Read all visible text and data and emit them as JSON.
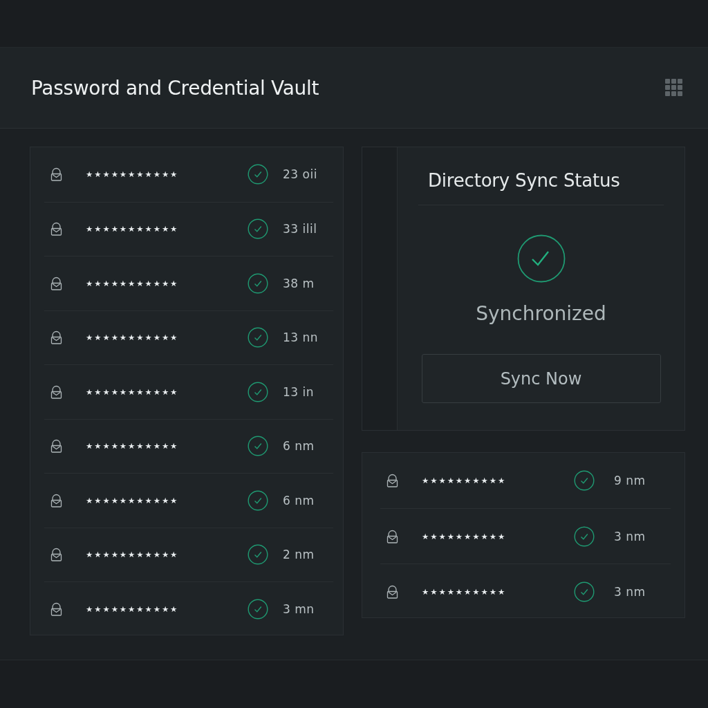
{
  "header": {
    "title": "Password and Credential Vault"
  },
  "credentials": [
    {
      "secret": "★★★★★★★★★★★",
      "time": "23 oii"
    },
    {
      "secret": "★★★★★★★★★★★",
      "time": "33 ilil"
    },
    {
      "secret": "★★★★★★★★★★★",
      "time": "38 m"
    },
    {
      "secret": "★★★★★★★★★★★",
      "time": "13 nn"
    },
    {
      "secret": "★★★★★★★★★★★",
      "time": "13 in"
    },
    {
      "secret": "★★★★★★★★★★★",
      "time": "6 nm"
    },
    {
      "secret": "★★★★★★★★★★★",
      "time": "6 nm"
    },
    {
      "secret": "★★★★★★★★★★★",
      "time": "2 nm"
    },
    {
      "secret": "★★★★★★★★★★★",
      "time": "3 mn"
    }
  ],
  "sync_panel": {
    "title": "Directory Sync Status",
    "status": "Synchronized",
    "button": "Sync Now"
  },
  "recent_credentials": [
    {
      "secret": "★★★★★★★★★★",
      "time": "9 nm"
    },
    {
      "secret": "★★★★★★★★★★",
      "time": "3 nm"
    },
    {
      "secret": "★★★★★★★★★★",
      "time": "3 nm"
    }
  ]
}
